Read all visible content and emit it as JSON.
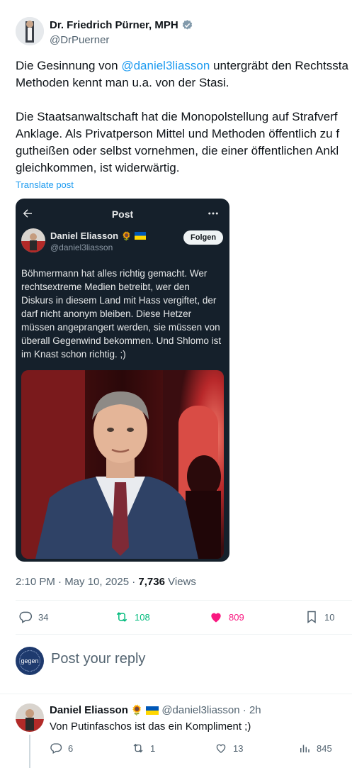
{
  "author": {
    "name": "Dr. Friedrich Pürner, MPH",
    "handle": "@DrPuerner"
  },
  "tweet": {
    "line1_pre": "Die Gesinnung von ",
    "line1_mention": "@daniel3liasson",
    "line1_post": " untergräbt den Rechtssta",
    "line2": "Methoden kennt man u.a. von der Stasi.",
    "line3": "Die Staatsanwaltschaft hat die Monopolstellung auf Strafverf",
    "line4": "Anklage. Als Privatperson Mittel und Methoden öffentlich zu f",
    "line5": "gutheißen oder selbst vornehmen, die einer öffentlichen Ankl",
    "line6": "gleichkommen, ist widerwärtig.",
    "translate": "Translate post"
  },
  "embedded": {
    "header_title": "Post",
    "name": "Daniel Eliasson",
    "handle": "@daniel3liasson",
    "follow_label": "Folgen",
    "lines": [
      "Böhmermann hat alles richtig gemacht. Wer",
      "rechtsextreme Medien betreibt, wer den",
      "Diskurs in diesem Land mit Hass vergiftet, der",
      "darf nicht anonym bleiben. Diese Hetzer",
      "müssen angeprangert werden, sie müssen von",
      "überall Gegenwind bekommen. Und Shlomo ist",
      "im Knast schon richtig. ;)"
    ]
  },
  "meta": {
    "time": "2:10 PM · May 10, 2025 · ",
    "views_count": "7,736",
    "views_label": " Views"
  },
  "stats": {
    "replies": "34",
    "reposts": "108",
    "likes": "809",
    "bookmarks": "10"
  },
  "reply_box": {
    "placeholder": "Post your reply",
    "avatar_text": "gegen"
  },
  "reply": {
    "name": "Daniel Eliasson",
    "handle": "@daniel3liasson · 2h",
    "text": "Von Putinfaschos ist das ein Kompliment ;)",
    "replies": "6",
    "reposts": "1",
    "likes": "13",
    "views": "845"
  },
  "colors": {
    "link": "#1d9bf0",
    "repost_green": "#00ba7c",
    "like_pink": "#f91880",
    "verified": "#829aab"
  }
}
